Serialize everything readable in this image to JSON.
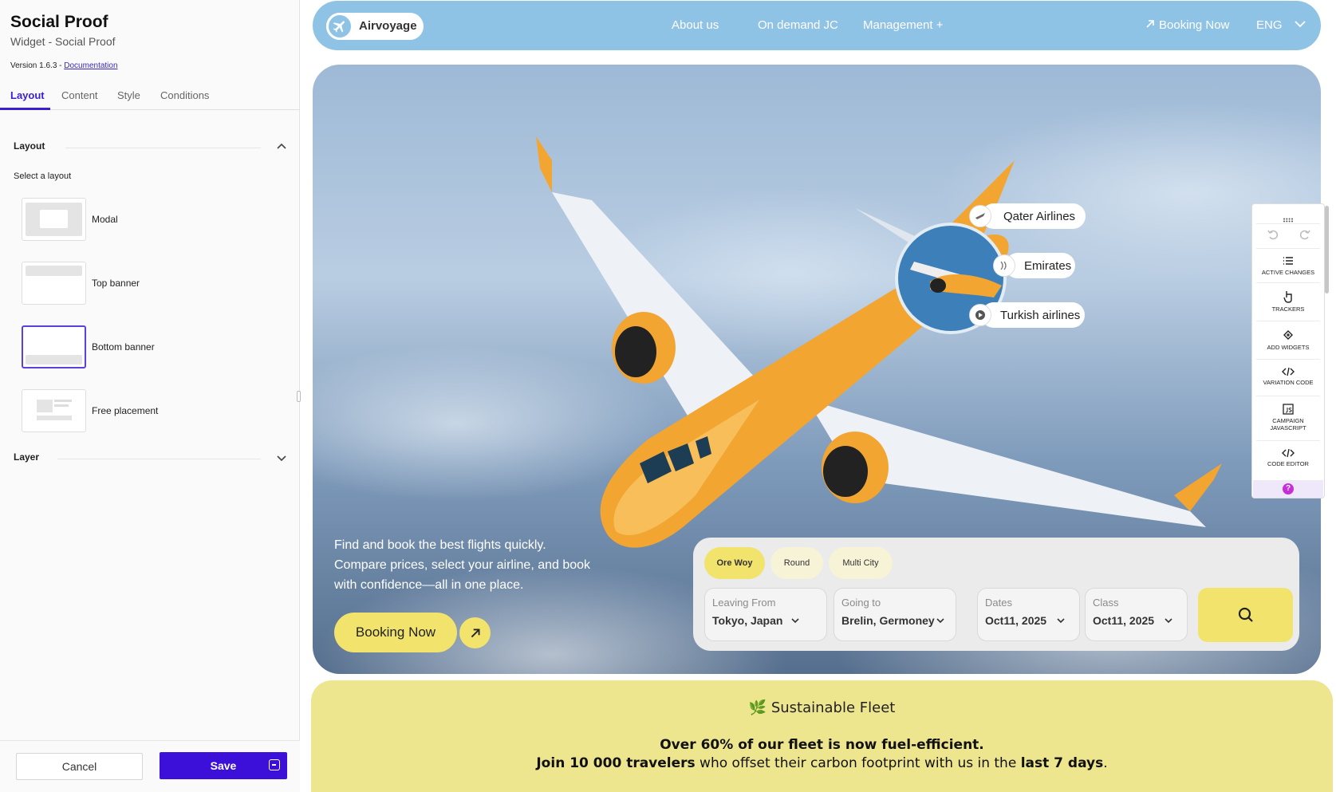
{
  "panel": {
    "title": "Social Proof",
    "subtitle": "Widget - Social Proof",
    "version": "Version 1.6.3 - ",
    "doc_link": "Documentation",
    "tabs": [
      "Layout",
      "Content",
      "Style",
      "Conditions"
    ],
    "active_tab": "Layout",
    "layout_section": "Layout",
    "select_label": "Select a layout",
    "layouts": [
      "Modal",
      "Top banner",
      "Bottom banner",
      "Free placement"
    ],
    "selected_layout": "Bottom banner",
    "layer_section": "Layer",
    "cancel": "Cancel",
    "save": "Save"
  },
  "site": {
    "brand": "Airvoyage",
    "nav": [
      "About us",
      "On demand JC",
      "Management +"
    ],
    "booking_link": "Booking Now",
    "lang": "ENG",
    "airlines": [
      "Qater Airlines",
      "Emirates",
      "Turkish airlines"
    ],
    "hero_text": "Find and book the best flights quickly. Compare prices, select your airline, and book with confidence—all in one place.",
    "book_button": "Booking Now",
    "trip_types": [
      "Ore Woy",
      "Round",
      "Multi City"
    ],
    "active_trip": "Ore Woy",
    "fields": [
      {
        "label": "Leaving From",
        "value": "Tokyo, Japan"
      },
      {
        "label": "Going to",
        "value": "Brelin, Germoney"
      },
      {
        "label": "Dates",
        "value": "Oct11, 2025"
      },
      {
        "label": "Class",
        "value": "Oct11, 2025"
      }
    ]
  },
  "toolbar": {
    "items": [
      "ACTIVE CHANGES",
      "TRACKERS",
      "ADD WIDGETS",
      "VARIATION CODE",
      "CAMPAIGN JAVASCRIPT",
      "CODE EDITOR"
    ],
    "help": "?"
  },
  "banner": {
    "emoji": "🌿",
    "title": "Sustainable Fleet",
    "line1": "Over 60% of our fleet is now fuel-efficient.",
    "line2_bold": "Join 10 000 travelers",
    "line2_mid": " who offset their carbon footprint with us in the ",
    "line2_bold2": "last 7 days",
    "line2_end": "."
  },
  "colors": {
    "accent": "#3c10d8",
    "nav_bg": "#8fc3e6",
    "yellow": "#f1e36c",
    "banner_bg": "#eee58f",
    "plane": "#f2a531"
  }
}
